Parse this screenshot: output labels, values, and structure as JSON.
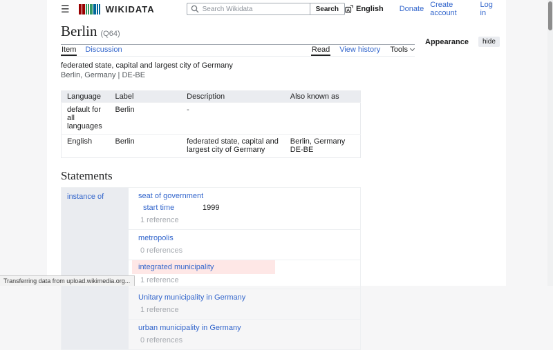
{
  "colors": {
    "accent_link": "#3366cc",
    "table_header_bg": "#eaecf0",
    "statement_highlight_bg": "#fee7e6",
    "logo_red": "#990000",
    "logo_green": "#339966",
    "logo_blue": "#006699"
  },
  "header": {
    "logo_text": "WIKIDATA",
    "search": {
      "placeholder": "Search Wikidata",
      "button_label": "Search"
    },
    "language_label": "English",
    "links": [
      "Donate",
      "Create account",
      "Log in"
    ]
  },
  "entity": {
    "title": "Berlin",
    "id": "(Q64)",
    "description": "federated state, capital and largest city of Germany",
    "aliases": "Berlin, Germany | DE-BE"
  },
  "tabs": {
    "left": [
      "Item",
      "Discussion"
    ],
    "right": [
      "Read",
      "View history",
      "Tools"
    ],
    "appearance_label": "Appearance",
    "appearance_hide": "hide"
  },
  "terms_table": {
    "headers": [
      "Language",
      "Label",
      "Description",
      "Also known as"
    ],
    "rows": [
      {
        "language": "default for all languages",
        "label": "Berlin",
        "description": "-",
        "also_known_as": [
          "",
          ""
        ]
      },
      {
        "language": "English",
        "label": "Berlin",
        "description": "federated state, capital and largest city of Germany",
        "also_known_as": [
          "Berlin, Germany",
          "DE-BE"
        ]
      }
    ]
  },
  "statements": {
    "heading": "Statements",
    "property": "instance of",
    "values": [
      {
        "label": "seat of government",
        "qualifier": {
          "property": "start time",
          "value": "1999"
        },
        "references": "1 reference"
      },
      {
        "label": "metropolis",
        "references": "0 references"
      },
      {
        "label": "integrated municipality",
        "references": "1 reference"
      },
      {
        "label": "Unitary municipality in Germany",
        "references": "1 reference"
      },
      {
        "label": "urban municipality in Germany",
        "references": "0 references"
      }
    ]
  },
  "status_bar": "Transferring data from upload.wikimedia.org..."
}
